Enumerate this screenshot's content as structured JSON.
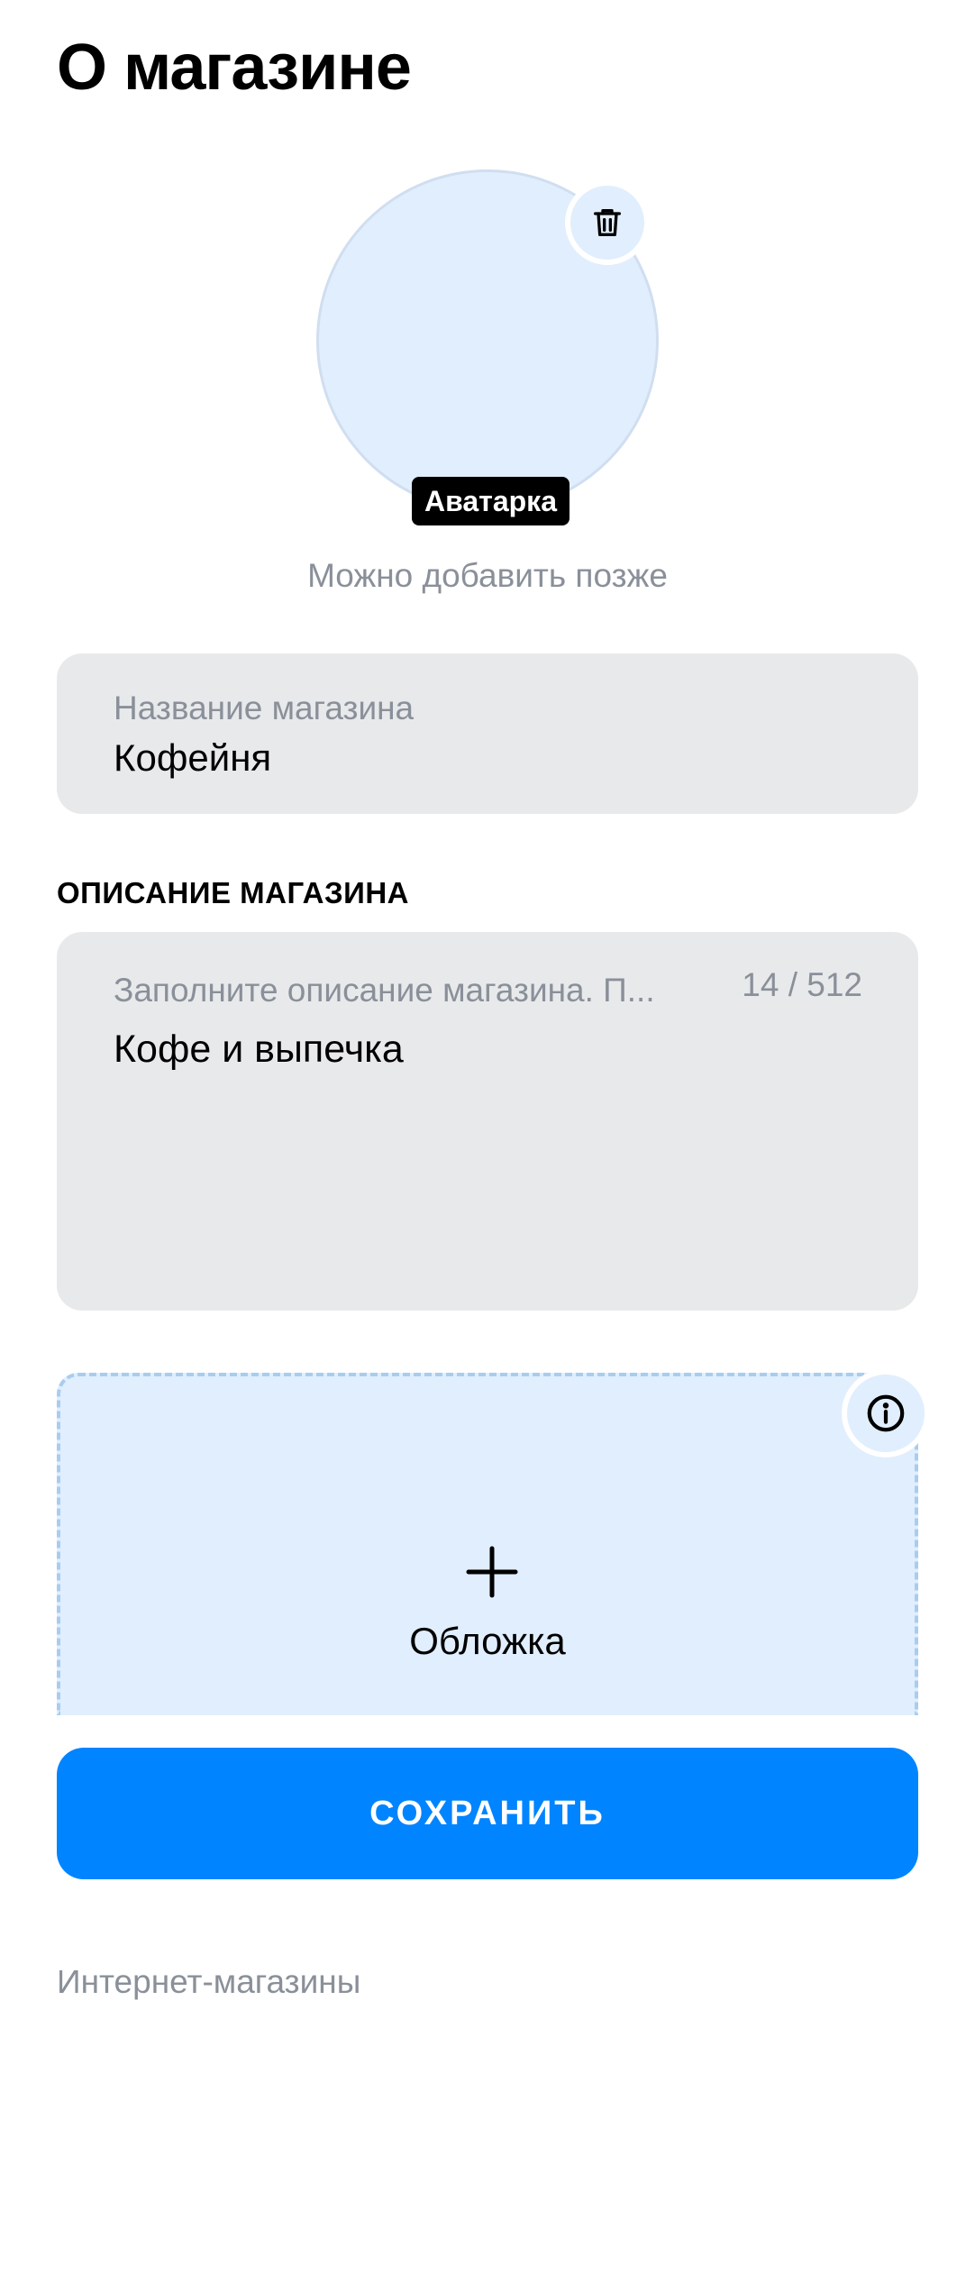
{
  "page": {
    "title": "О магазине"
  },
  "avatar": {
    "badge": "Аватарка",
    "hint": "Можно добавить позже",
    "delete_icon": "trash-icon"
  },
  "name_field": {
    "label": "Название магазина",
    "value": "Кофейня"
  },
  "description": {
    "section_title": "ОПИСАНИЕ МАГАЗИНА",
    "placeholder": "Заполните описание магазина. П...",
    "counter": "14 / 512",
    "value": "Кофе и выпечка"
  },
  "cover": {
    "label": "Обложка",
    "info_icon": "info-icon",
    "add_icon": "plus-icon"
  },
  "save_button": {
    "label": "СОХРАНИТЬ"
  },
  "footer": {
    "text": "Интернет-магазины"
  },
  "colors": {
    "accent": "#0084ff",
    "field_bg": "#e8e9eb",
    "light_blue": "#e1eefd",
    "hint": "#8a9099"
  }
}
